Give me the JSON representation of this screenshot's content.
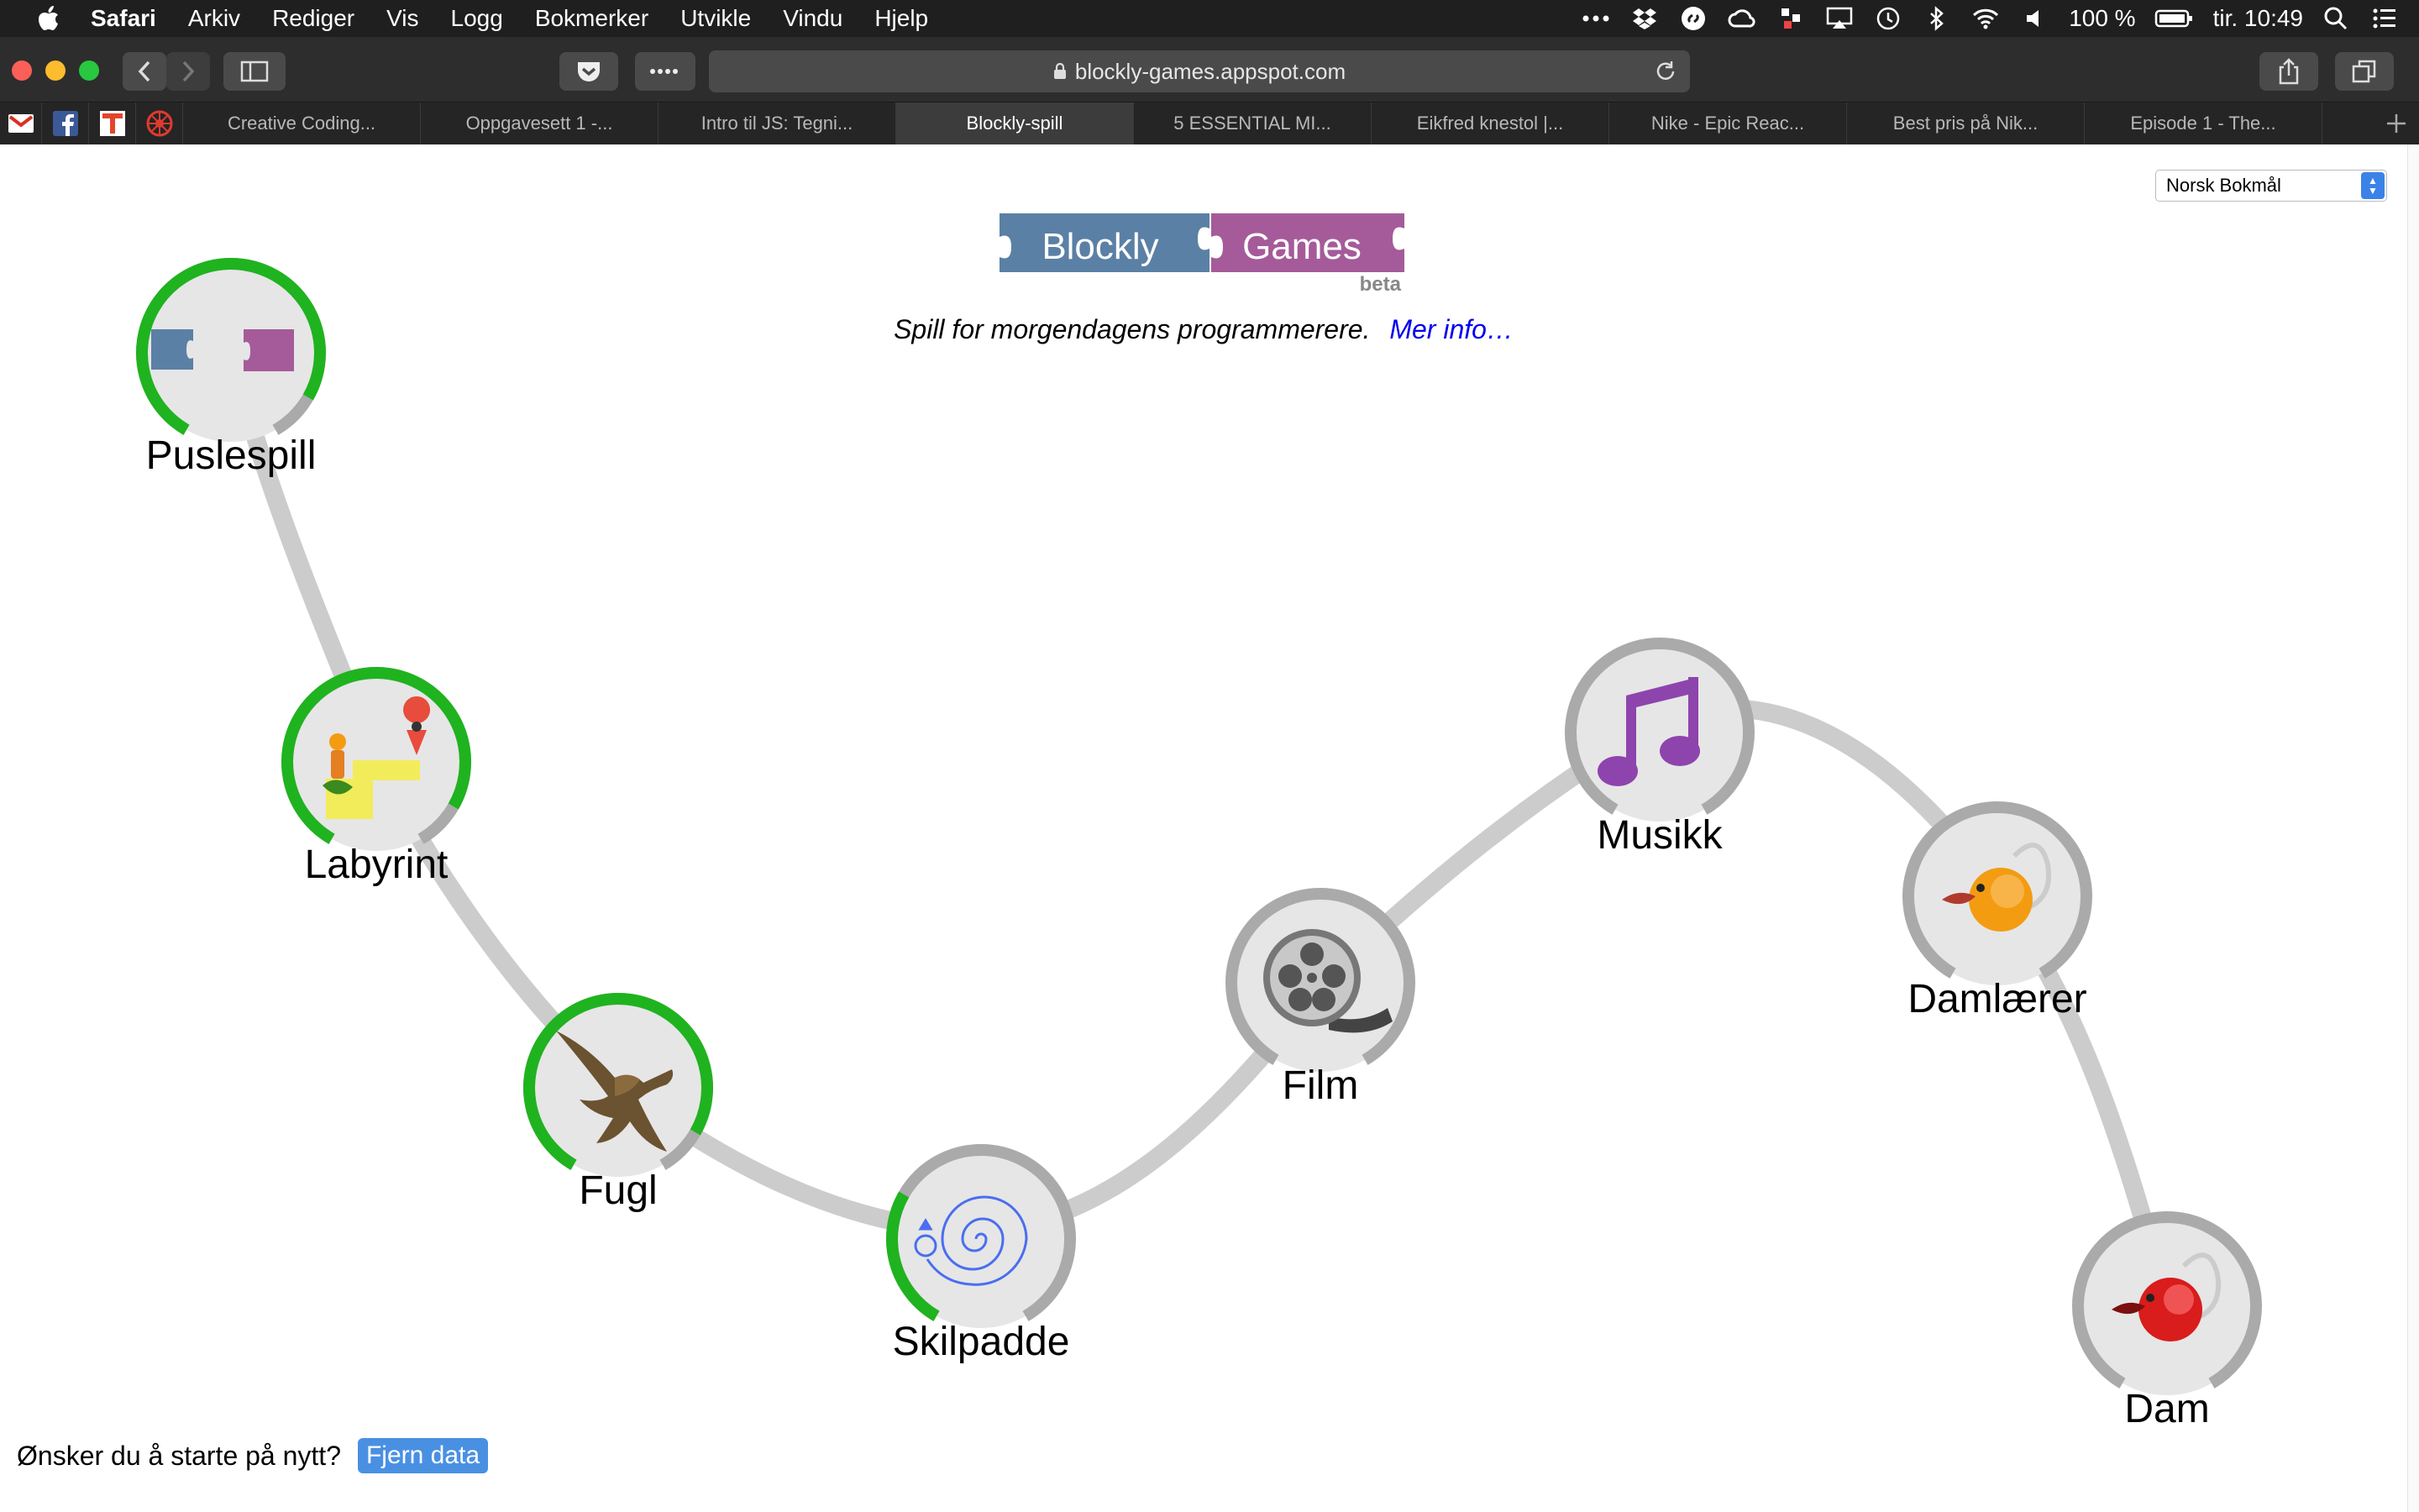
{
  "menubar": {
    "app": "Safari",
    "items": [
      "Arkiv",
      "Rediger",
      "Vis",
      "Logg",
      "Bokmerker",
      "Utvikle",
      "Vindu",
      "Hjelp"
    ],
    "battery": "100 %",
    "clock": "tir. 10:49"
  },
  "toolbar": {
    "url": "blockly-games.appspot.com"
  },
  "tabs": [
    {
      "label": "Creative Coding..."
    },
    {
      "label": "Oppgavesett 1 -..."
    },
    {
      "label": "Intro til JS: Tegni..."
    },
    {
      "label": "Blockly-spill",
      "active": true
    },
    {
      "label": "5 ESSENTIAL MI..."
    },
    {
      "label": "Eikfred knestol |..."
    },
    {
      "label": "Nike - Epic Reac..."
    },
    {
      "label": "Best pris på Nik..."
    },
    {
      "label": "Episode 1 - The..."
    }
  ],
  "page": {
    "language": "Norsk Bokmål",
    "logo": {
      "left": "Blockly",
      "right": "Games",
      "badge": "beta"
    },
    "tagline": "Spill for morgendagens programmerere.",
    "more_info": "Mer info…",
    "games": [
      {
        "name": "Puslespill",
        "progress": 0.9,
        "icon": "puzzle-icon"
      },
      {
        "name": "Labyrint",
        "progress": 0.9,
        "icon": "maze-icon"
      },
      {
        "name": "Fugl",
        "progress": 0.9,
        "icon": "bird-icon"
      },
      {
        "name": "Skilpadde",
        "progress": 0.3,
        "icon": "turtle-spiral-icon"
      },
      {
        "name": "Film",
        "progress": 0,
        "icon": "film-reel-icon"
      },
      {
        "name": "Musikk",
        "progress": 0,
        "icon": "music-note-icon"
      },
      {
        "name": "Damlærer",
        "progress": 0,
        "icon": "pond-tutor-duck-icon"
      },
      {
        "name": "Dam",
        "progress": 0,
        "icon": "pond-duck-icon"
      }
    ],
    "reset_prompt": "Ønsker du å starte på nytt?",
    "reset_button": "Fjern data"
  },
  "colors": {
    "progress": "#1fb31f",
    "track": "#aaaaaa",
    "path": "#cccccc",
    "blockly_blue": "#5b80a5",
    "games_purple": "#a55b99"
  }
}
